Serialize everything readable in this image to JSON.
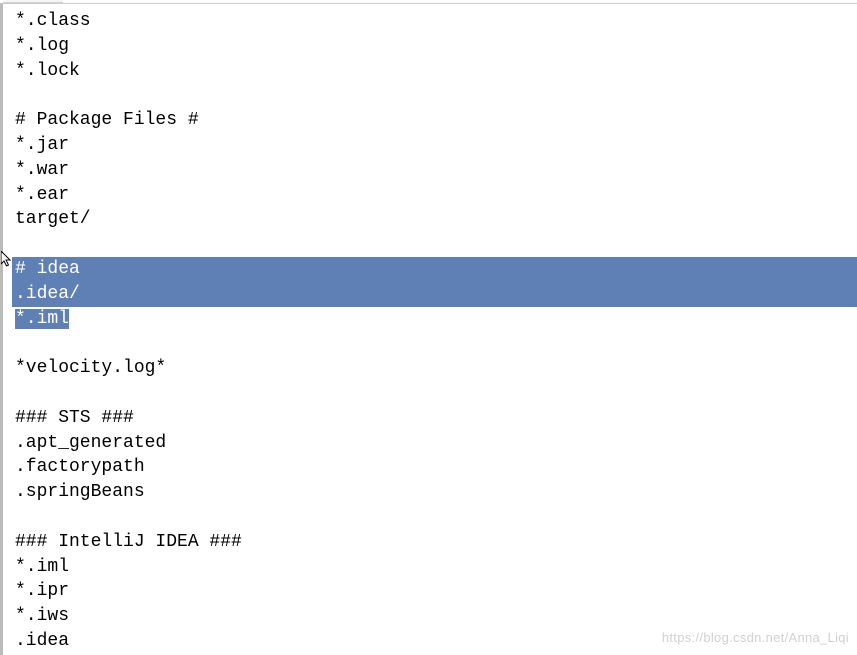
{
  "editor": {
    "lines": {
      "l0": "*.class",
      "l1": "*.log",
      "l2": "*.lock",
      "l3": "",
      "l4": "# Package Files #",
      "l5": "*.jar",
      "l6": "*.war",
      "l7": "*.ear",
      "l8": "target/",
      "l9": "",
      "l10": "# idea",
      "l11": ".idea/",
      "l12": "*.iml",
      "l13": "",
      "l14": "*velocity.log*",
      "l15": "",
      "l16": "### STS ###",
      "l17": ".apt_generated",
      "l18": ".factorypath",
      "l19": ".springBeans",
      "l20": "",
      "l21": "### IntelliJ IDEA ###",
      "l22": "*.iml",
      "l23": "*.ipr",
      "l24": "*.iws",
      "l25": ".idea"
    }
  },
  "watermark": "https://blog.csdn.net/Anna_Liqi"
}
